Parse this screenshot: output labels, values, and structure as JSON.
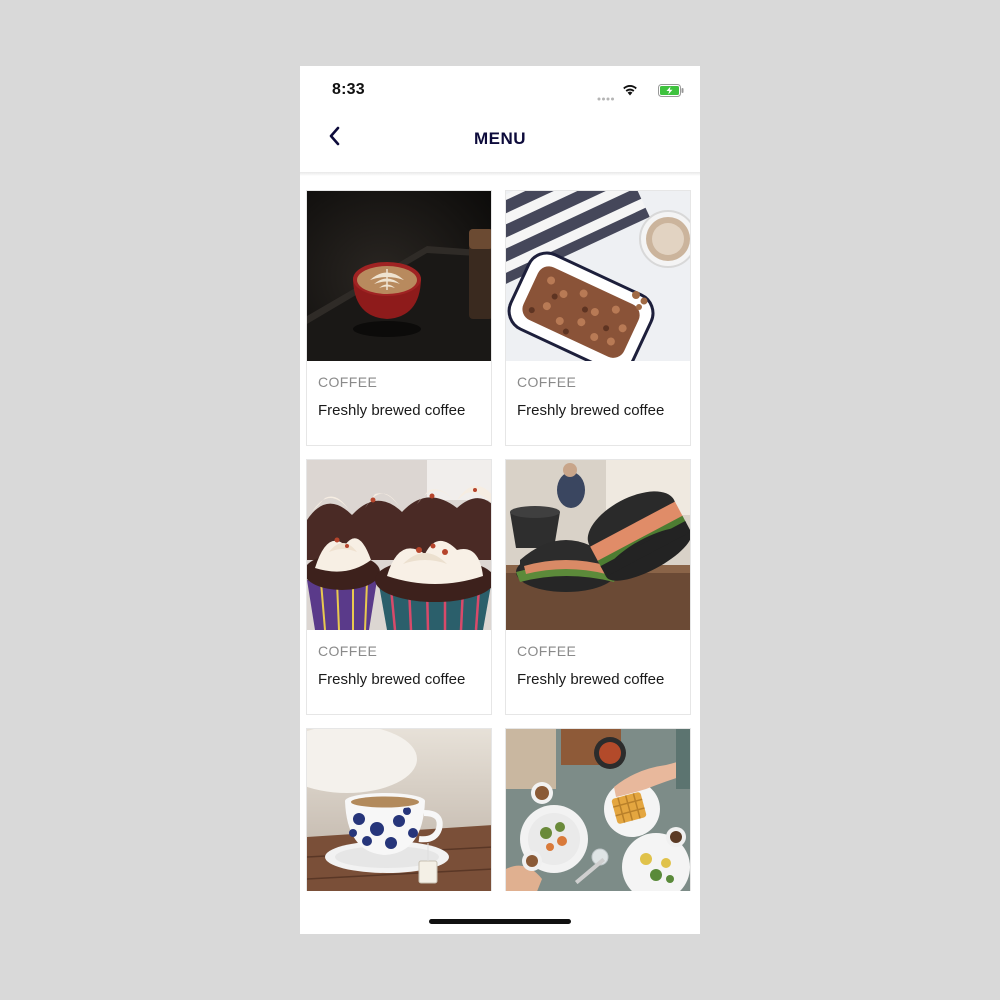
{
  "status_bar": {
    "time": "8:33",
    "icons": [
      "signal-dots-icon",
      "wifi-icon",
      "battery-charging-icon"
    ]
  },
  "header": {
    "back_icon": "chevron-left-icon",
    "title": "MENU"
  },
  "menu_items": [
    {
      "category": "COFFEE",
      "title": "Freshly brewed coffee",
      "image": "latte-art-cup-photo"
    },
    {
      "category": "COFFEE",
      "title": "Freshly brewed coffee",
      "image": "granola-dish-coffee-photo"
    },
    {
      "category": "COFFEE",
      "title": "Freshly brewed coffee",
      "image": "cupcakes-photo"
    },
    {
      "category": "COFFEE",
      "title": "Freshly brewed coffee",
      "image": "black-bun-sandwich-photo"
    },
    {
      "category": "",
      "title": "",
      "image": "blue-floral-teacup-photo"
    },
    {
      "category": "",
      "title": "",
      "image": "brunch-table-photo"
    }
  ],
  "colors": {
    "title": "#0d0b3b",
    "category": "#8a8a8a",
    "background": "#d9d9d9"
  }
}
